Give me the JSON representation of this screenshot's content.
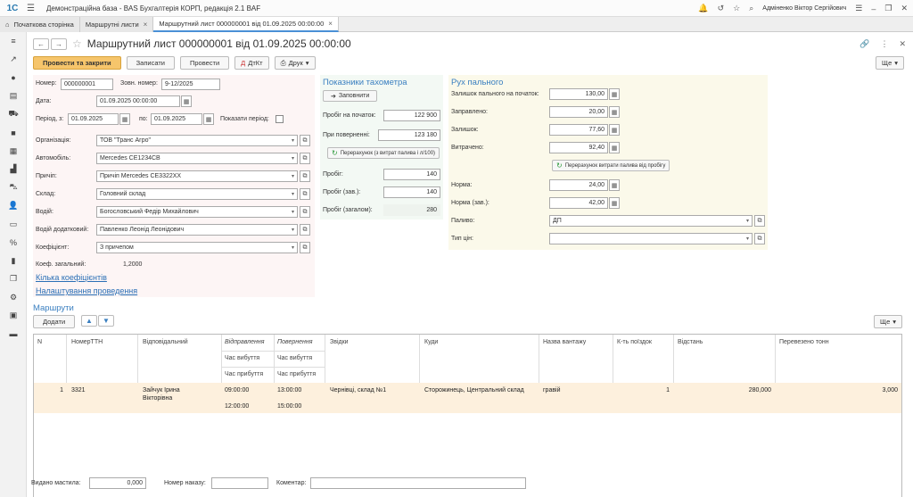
{
  "app": {
    "logo": "1С",
    "title": "Демонстраційна база - BAS Бухгалтерія КОРП, редакція 2.1 BAF",
    "user": "Адміненко Віктор Сергійович"
  },
  "tabs": [
    {
      "label": "Початкова сторінка"
    },
    {
      "label": "Маршрутні листи",
      "close": "×"
    },
    {
      "label": "Маршрутний лист 000000001 від 01.09.2025 00:00:00",
      "close": "×"
    }
  ],
  "doc": {
    "title": "Маршрутний лист 000000001 від 01.09.2025 00:00:00",
    "nav_back": "←",
    "nav_forward": "→"
  },
  "toolbar": {
    "post_close": "Провести та закрити",
    "save": "Записати",
    "post": "Провести",
    "dtkt": "ДтКт",
    "print": "Друк",
    "more": "Ще"
  },
  "header": {
    "number_label": "Номер:",
    "number_value": "000000001",
    "ext_number_label": "Зовн. номер:",
    "ext_number_value": "9-12/2025",
    "date_label": "Дата:",
    "date_value": "01.09.2025 00:00:00",
    "period_from_label": "Період, з:",
    "period_from_value": "01.09.2025",
    "period_to_label": "по:",
    "period_to_value": "01.09.2025",
    "show_period_label": "Показати період:"
  },
  "fields": {
    "org_label": "Організація:",
    "org_value": "ТОВ \"Транс Агро\"",
    "car_label": "Автомобіль:",
    "car_value": "Mercedes CE1234CB",
    "trailer_label": "Причіп:",
    "trailer_value": "Причіп Mercedes CE3322XX",
    "warehouse_label": "Склад:",
    "warehouse_value": "Головний склад",
    "driver_label": "Водій:",
    "driver_value": "Богословський Федір Михайлович",
    "driver2_label": "Водій додатковий:",
    "driver2_value": "Павленко Леонід Леонідович",
    "coef_label": "Коефіцієнт:",
    "coef_value": "З причепом",
    "coef_total_label": "Коеф. загальний:",
    "coef_total_value": "1,2000",
    "link_coefs": "Кілька коефіцієнтів",
    "link_settings": "Налаштування проведення"
  },
  "tacho": {
    "title": "Показники тахометра",
    "fill_btn": "Заповнити",
    "start_label": "Пробіг на початок:",
    "start_value": "122 900",
    "return_label": "При поверненні:",
    "return_value": "123 180",
    "recalc_btn": "Перерахунок (з витрат палива і л/100)",
    "mileage_label": "Пробіг:",
    "mileage_value": "140",
    "mileage_load_label": "Пробіг (зав.):",
    "mileage_load_value": "140",
    "mileage_total_label": "Пробіг (загалом):",
    "mileage_total_value": "280"
  },
  "fuel": {
    "title": "Рух пального",
    "start_label": "Залишок пального на початок:",
    "start_value": "130,00",
    "refuel_label": "Заправлено:",
    "refuel_value": "20,00",
    "rest_label": "Залишок:",
    "rest_value": "77,60",
    "spent_label": "Витрачено:",
    "spent_value": "92,40",
    "recalc_btn": "Перерахунок витрати палива від пробігу",
    "norm_label": "Норма:",
    "norm_value": "24,00",
    "norm_load_label": "Норма (зав.):",
    "norm_load_value": "42,00",
    "fuel_label": "Паливо:",
    "fuel_value": "ДП",
    "price_type_label": "Тип цін:",
    "price_type_value": ""
  },
  "routes": {
    "title": "Маршрути",
    "add_btn": "Додати",
    "more": "Ще",
    "columns": {
      "n": "N",
      "ttn": "НомерТТН",
      "responsible": "Відповідальний",
      "departure": "Відправлення",
      "departure_time": "Час вибуття",
      "arrival_time": "Час прибуття",
      "return": "Повернення",
      "return_departure": "Час вибуття",
      "return_arrival": "Час прибуття",
      "from": "Звідки",
      "to": "Куди",
      "cargo": "Назва вантажу",
      "trips": "К-ть поїздок",
      "distance": "Відстань",
      "tons": "Перевезено тонн"
    },
    "rows": [
      {
        "n": "1",
        "ttn": "3321",
        "responsible_1": "Зайчук Ірина",
        "responsible_2": "Вікторівна",
        "dep_time": "09:00:00",
        "arr_time": "12:00:00",
        "ret_dep": "13:00:00",
        "ret_arr": "15:00:00",
        "from": "Чернівці, склад №1",
        "to": "Сторожинець, Центральний склад",
        "cargo": "гравій",
        "trips": "1",
        "distance": "280,000",
        "tons": "3,000"
      }
    ]
  },
  "footer": {
    "oil_label": "Видано мастила:",
    "oil_value": "0,000",
    "order_label": "Номер наказу:",
    "order_value": "",
    "comment_label": "Коментар:",
    "comment_value": ""
  }
}
